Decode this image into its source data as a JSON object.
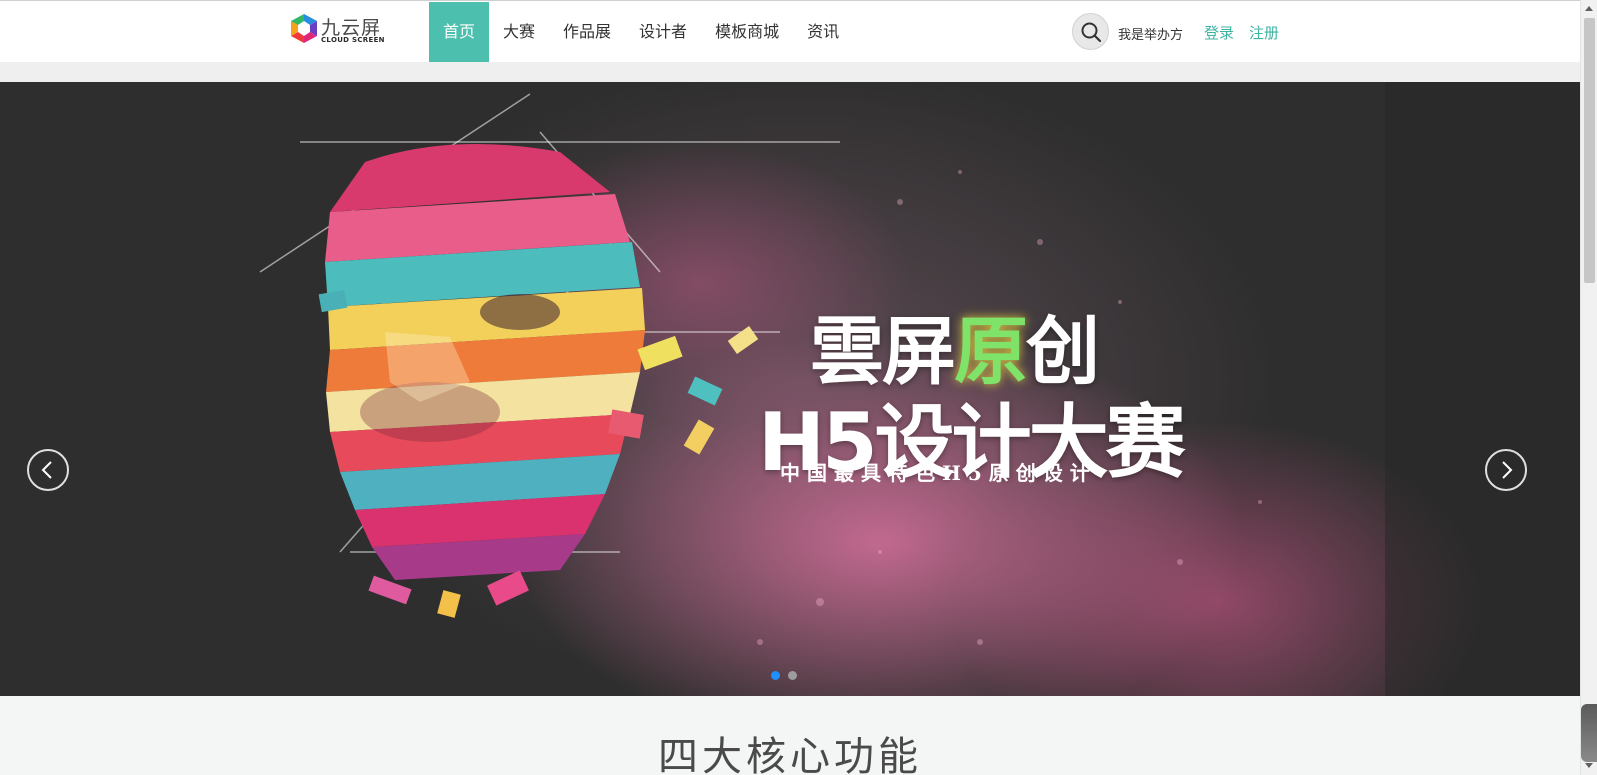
{
  "brand": {
    "name_cn": "九云屏",
    "name_en": "CLOUD SCREEN",
    "icon": "cube-logo-icon"
  },
  "nav": {
    "items": [
      {
        "label": "首页",
        "active": true
      },
      {
        "label": "大赛",
        "active": false
      },
      {
        "label": "作品展",
        "active": false
      },
      {
        "label": "设计者",
        "active": false
      },
      {
        "label": "模板商城",
        "active": false
      },
      {
        "label": "资讯",
        "active": false
      }
    ]
  },
  "header_right": {
    "search_icon": "search-icon",
    "organizer_label": "我是举办方",
    "login_label": "登录",
    "register_label": "注册"
  },
  "banner": {
    "headline_line1_a": "雲屏",
    "headline_line1_b": "原",
    "headline_line1_c": "创",
    "headline_line2": "H5设计大赛",
    "tagline": "中国最具特色H5原创设计",
    "prev_icon": "chevron-left-icon",
    "next_icon": "chevron-right-icon",
    "slides": 2,
    "current_slide": 1
  },
  "section": {
    "title": "四大核心功能"
  },
  "colors": {
    "accent": "#4cbfae",
    "link": "#3cb4a2",
    "dot_active": "#1e90ff"
  }
}
